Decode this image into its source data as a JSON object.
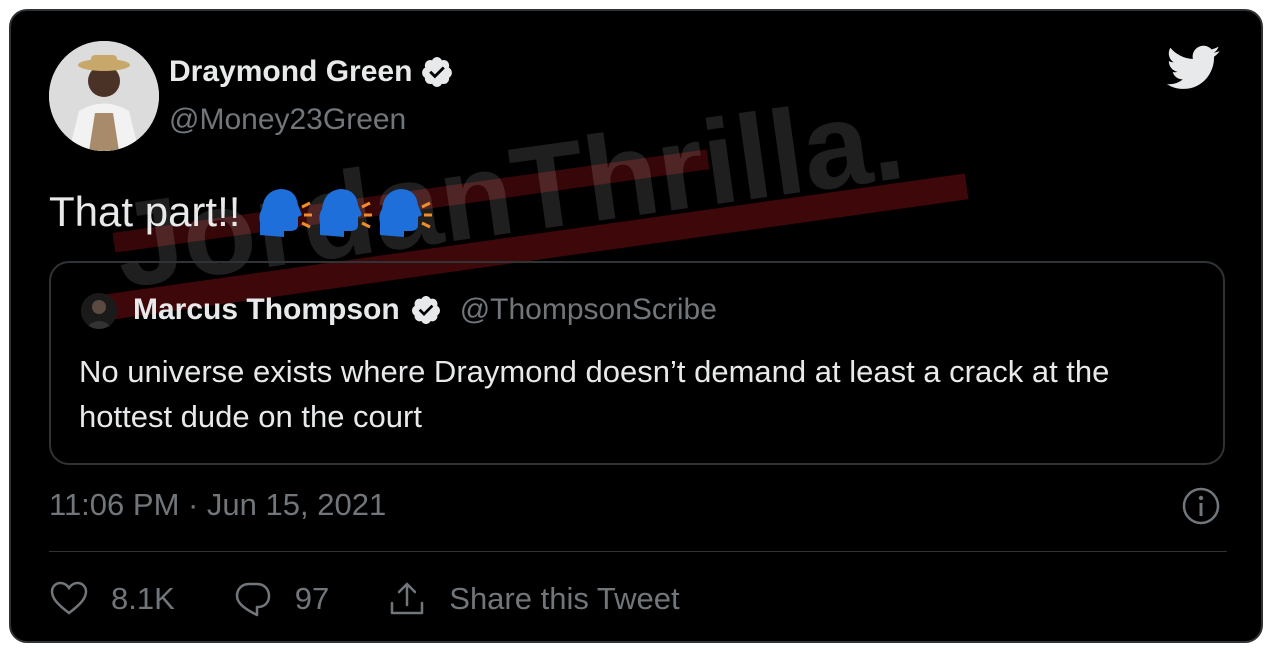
{
  "tweet": {
    "display_name": "Draymond Green",
    "handle": "@Money23Green",
    "text": "That part!!",
    "emoji_name": "speaking-head-emoji",
    "timestamp": "11:06 PM · Jun 15, 2021",
    "likes": "8.1K",
    "replies": "97",
    "share_label": "Share this Tweet"
  },
  "quoted": {
    "display_name": "Marcus Thompson",
    "handle": "@ThompsonScribe",
    "text": "No universe exists where Draymond doesn’t demand at least a crack at the hottest dude on the court"
  },
  "watermark": {
    "text": "JordanThrilla."
  },
  "colors": {
    "background": "#000000",
    "primary_text": "#e7e9ea",
    "secondary_text": "#71767b",
    "border": "#2f3336",
    "verified": "#e7e9ea",
    "watermark_red": "#b3141a"
  },
  "icons": [
    "verified-badge-icon",
    "twitter-bird-icon",
    "info-icon",
    "heart-icon",
    "reply-icon",
    "share-icon"
  ]
}
